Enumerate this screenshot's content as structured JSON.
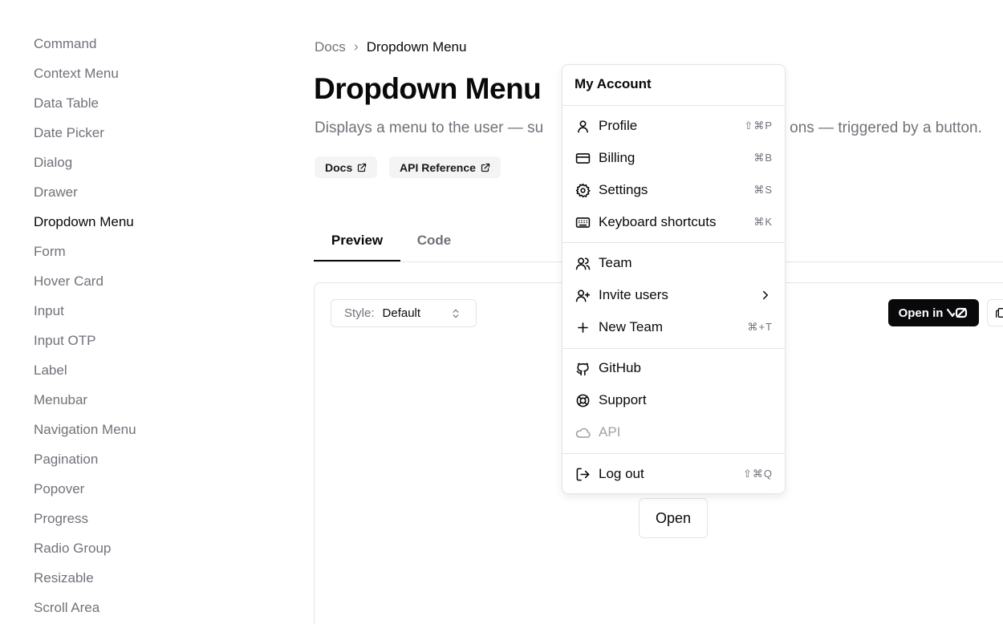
{
  "sidebar": {
    "items": [
      {
        "label": "Command"
      },
      {
        "label": "Context Menu"
      },
      {
        "label": "Data Table"
      },
      {
        "label": "Date Picker"
      },
      {
        "label": "Dialog"
      },
      {
        "label": "Drawer"
      },
      {
        "label": "Dropdown Menu",
        "active": true
      },
      {
        "label": "Form"
      },
      {
        "label": "Hover Card"
      },
      {
        "label": "Input"
      },
      {
        "label": "Input OTP"
      },
      {
        "label": "Label"
      },
      {
        "label": "Menubar"
      },
      {
        "label": "Navigation Menu"
      },
      {
        "label": "Pagination"
      },
      {
        "label": "Popover"
      },
      {
        "label": "Progress"
      },
      {
        "label": "Radio Group"
      },
      {
        "label": "Resizable"
      },
      {
        "label": "Scroll Area"
      }
    ]
  },
  "breadcrumb": {
    "root": "Docs",
    "current": "Dropdown Menu"
  },
  "page": {
    "title": "Dropdown Menu",
    "description": "Displays a menu to the user — su",
    "description_tail": "ons — triggered by a button."
  },
  "badges": {
    "docs": "Docs",
    "api": "API Reference"
  },
  "tabs": {
    "preview": "Preview",
    "code": "Code"
  },
  "toolbar": {
    "style_label": "Style:",
    "style_value": "Default",
    "open_in": "Open in"
  },
  "preview": {
    "open_button": "Open"
  },
  "menu": {
    "label": "My Account",
    "items": [
      {
        "label": "Profile",
        "icon": "user-icon",
        "shortcut": "⇧⌘P"
      },
      {
        "label": "Billing",
        "icon": "credit-card-icon",
        "shortcut": "⌘B"
      },
      {
        "label": "Settings",
        "icon": "gear-icon",
        "shortcut": "⌘S"
      },
      {
        "label": "Keyboard shortcuts",
        "icon": "keyboard-icon",
        "shortcut": "⌘K"
      },
      {
        "label": "Team",
        "icon": "users-icon"
      },
      {
        "label": "Invite users",
        "icon": "user-plus-icon"
      },
      {
        "label": "New Team",
        "icon": "plus-icon",
        "shortcut": "⌘+T"
      },
      {
        "label": "GitHub",
        "icon": "github-icon"
      },
      {
        "label": "Support",
        "icon": "life-buoy-icon"
      },
      {
        "label": "API",
        "icon": "cloud-icon",
        "disabled": true
      },
      {
        "label": "Log out",
        "icon": "log-out-icon",
        "shortcut": "⇧⌘Q"
      }
    ]
  }
}
